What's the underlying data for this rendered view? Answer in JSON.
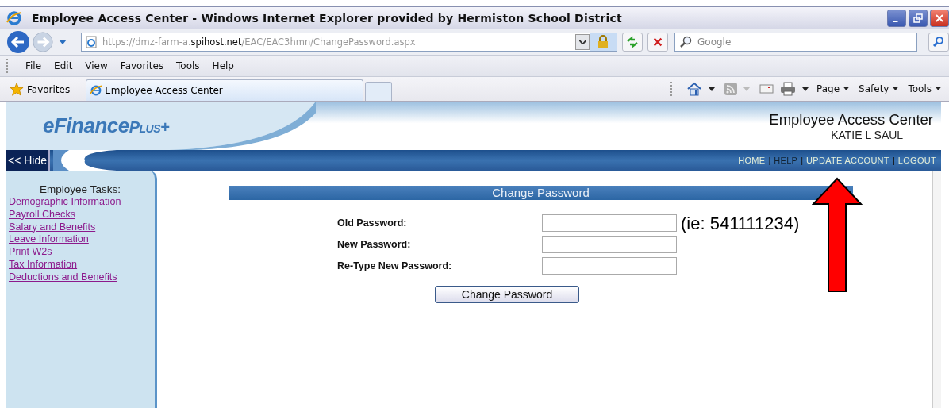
{
  "window": {
    "title": "Employee Access Center - Windows Internet Explorer provided by Hermiston School District"
  },
  "address_bar": {
    "url_prefix": "https://dmz-farm-a.",
    "url_domain": "spihost.net",
    "url_path": "/EAC/EAC3hmn/ChangePassword.aspx"
  },
  "search": {
    "placeholder": "Google"
  },
  "menu_bar": [
    "File",
    "Edit",
    "View",
    "Favorites",
    "Tools",
    "Help"
  ],
  "favorites_bar": {
    "label": "Favorites",
    "tabs": [
      {
        "label": "Employee Access Center",
        "selected": true
      }
    ]
  },
  "command_bar": [
    "Page",
    "Safety",
    "Tools"
  ],
  "page": {
    "logo": {
      "main": "eFinance",
      "suffix": "Plus+"
    },
    "app_title": "Employee Access Center",
    "user_name": "KATIE L SAUL",
    "hide_button": "<< Hide",
    "nav_separator": "|",
    "nav_links": [
      {
        "label": "HOME",
        "active": false
      },
      {
        "label": "HELP",
        "active": true
      },
      {
        "label": "UPDATE ACCOUNT",
        "active": false
      },
      {
        "label": "LOGOUT",
        "active": false
      }
    ],
    "sidebar": {
      "heading": "Employee Tasks:",
      "links": [
        "Demographic Information",
        "Payroll Checks",
        "Salary and Benefits",
        "Leave Information",
        "Print W2s",
        "Tax Information",
        "Deductions and Benefits"
      ]
    },
    "form": {
      "title": "Change Password",
      "fields": [
        {
          "label": "Old Password:"
        },
        {
          "label": "New Password:"
        },
        {
          "label": "Re-Type New Password:"
        }
      ],
      "submit": "Change Password"
    },
    "annotation": {
      "note": "(ie: 541111234)"
    }
  }
}
